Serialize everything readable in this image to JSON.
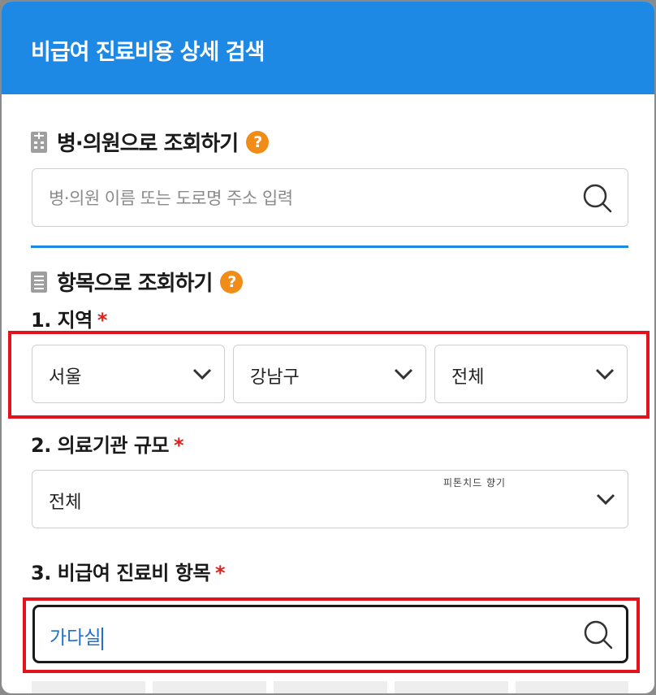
{
  "header": {
    "title": "비급여 진료비용 상세 검색"
  },
  "hospital_section": {
    "title": "병·의원으로 조회하기",
    "help": "?",
    "search_placeholder": "병·의원 이름 또는 도로명 주소 입력"
  },
  "item_section": {
    "title": "항목으로 조회하기",
    "help": "?",
    "region": {
      "label": "1. 지역",
      "required": "*",
      "selects": [
        "서울",
        "강남구",
        "전체"
      ]
    },
    "scale": {
      "label": "2. 의료기관 규모",
      "required": "*",
      "value": "전체",
      "watermark": "피톤치드 향기"
    },
    "item": {
      "label": "3. 비급여 진료비 항목",
      "required": "*",
      "input_value": "가다실"
    }
  },
  "colors": {
    "brand": "#1e88e5",
    "help": "#f28c18",
    "required": "#e0201b",
    "highlight": "#e4121a"
  }
}
